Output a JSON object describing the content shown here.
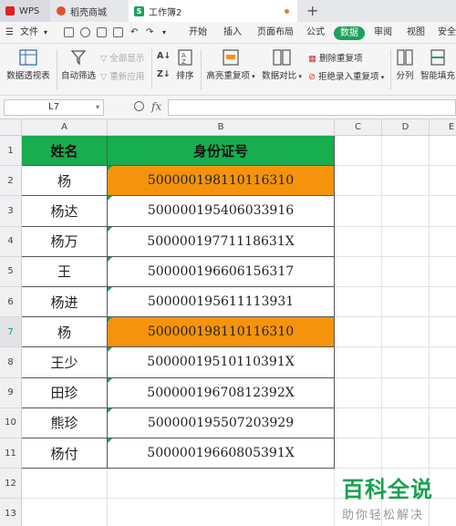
{
  "tabs": [
    {
      "label": "WPS"
    },
    {
      "label": "稻壳商城"
    },
    {
      "label": "工作簿2"
    }
  ],
  "menu": {
    "file": "文件",
    "items": [
      "开始",
      "插入",
      "页面布局",
      "公式",
      "数据",
      "审阅",
      "视图",
      "安全"
    ],
    "active": "数据"
  },
  "ribbon": {
    "pivot": "数据透视表",
    "autofilter": "自动筛选",
    "show_all": "全部显示",
    "reapply": "重新应用",
    "sort": "排序",
    "highlight_dup": "高亮重复项",
    "data_compare": "数据对比",
    "delete_dup": "删除重复项",
    "reject_dup": "拒绝录入重复项",
    "split": "分列",
    "smart_fill": "智能填充"
  },
  "formula_bar": {
    "name_box": "L7",
    "fx": "fx",
    "value": ""
  },
  "columns": [
    "A",
    "B",
    "C",
    "D",
    "E"
  ],
  "rows": [
    "1",
    "2",
    "3",
    "4",
    "5",
    "6",
    "7",
    "8",
    "9",
    "10",
    "11",
    "12",
    "13"
  ],
  "selected_row": "7",
  "table": {
    "headers": [
      "姓名",
      "身份证号"
    ],
    "rows": [
      {
        "name": "杨",
        "id": "500000198110116310",
        "dup": true
      },
      {
        "name": "杨达",
        "id": "500000195406033916",
        "dup": false
      },
      {
        "name": "杨万",
        "id": "50000019771118631X",
        "dup": false
      },
      {
        "name": "王",
        "id": "500000196606156317",
        "dup": false
      },
      {
        "name": "杨进",
        "id": "500000195611113931",
        "dup": false
      },
      {
        "name": "杨",
        "id": "500000198110116310",
        "dup": true
      },
      {
        "name": "王少",
        "id": "50000019510110391X",
        "dup": false
      },
      {
        "name": "田珍",
        "id": "50000019670812392X",
        "dup": false
      },
      {
        "name": "熊珍",
        "id": "500000195507203929",
        "dup": false
      },
      {
        "name": "杨付",
        "id": "50000019660805391X",
        "dup": false
      }
    ]
  },
  "colors": {
    "header_fill": "#18ad4f",
    "duplicate_fill": "#f5930c",
    "accent": "#1aa35a"
  },
  "watermark": {
    "title": "百科全说",
    "subtitle": "助你轻松解决"
  }
}
